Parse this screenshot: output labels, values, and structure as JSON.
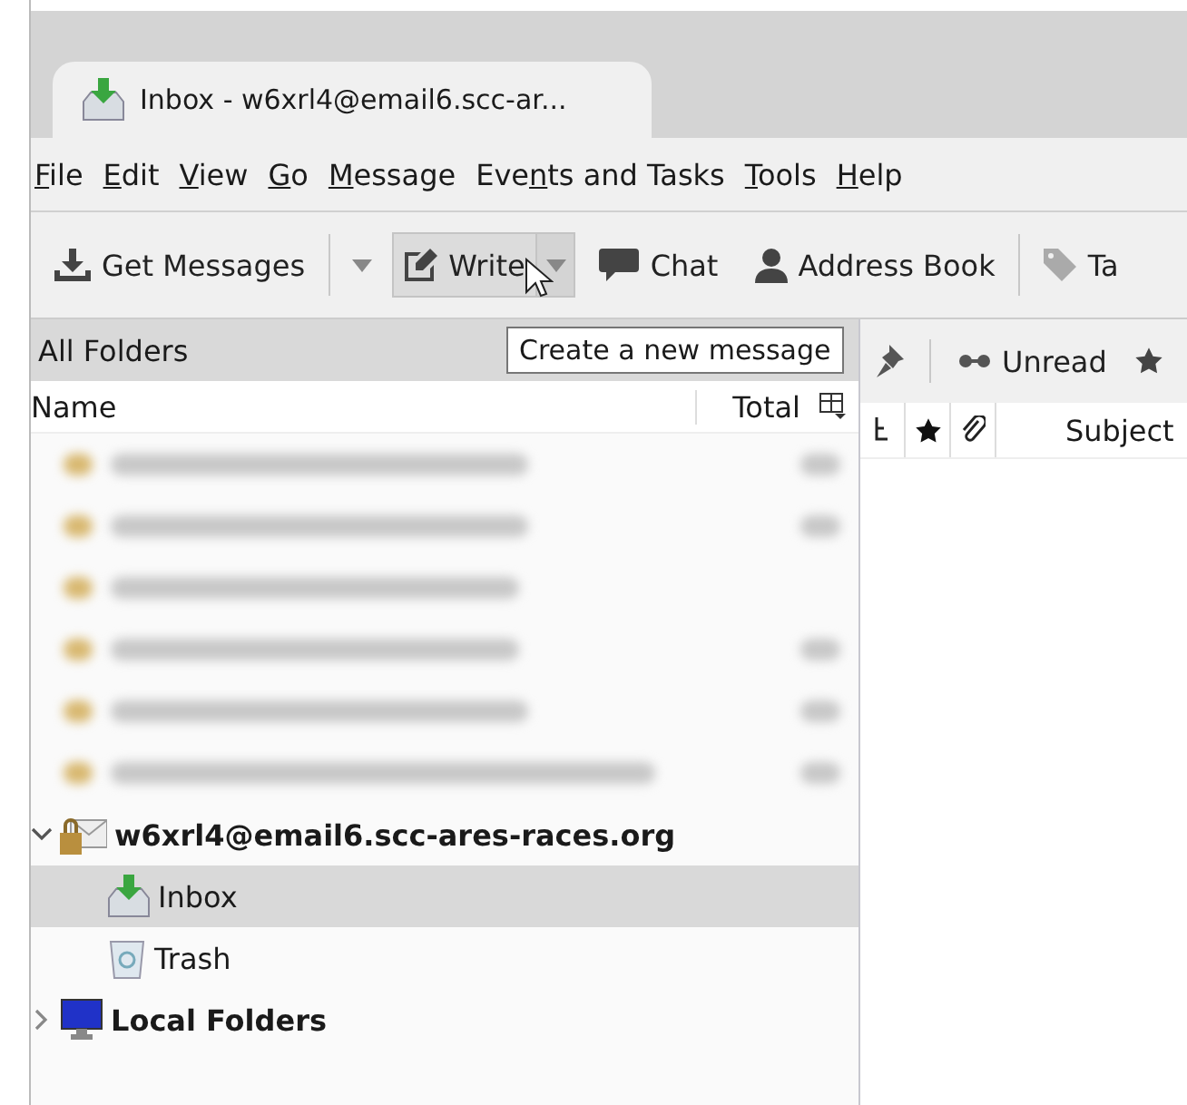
{
  "tab": {
    "title": "Inbox - w6xrl4@email6.scc-ar..."
  },
  "menu": [
    {
      "key": "F",
      "after": "ile"
    },
    {
      "key": "E",
      "after": "dit"
    },
    {
      "key": "V",
      "after": "iew"
    },
    {
      "key": "G",
      "after": "o"
    },
    {
      "key": "M",
      "after": "essage"
    },
    {
      "before": "Eve",
      "key": "n",
      "after": "ts and Tasks"
    },
    {
      "key": "T",
      "after": "ools"
    },
    {
      "key": "H",
      "after": "elp"
    }
  ],
  "toolbar": [
    {
      "kind": "get",
      "label": "Get Messages",
      "pressed": false
    },
    {
      "kind": "write",
      "label": "Write",
      "pressed": true
    },
    {
      "kind": "chat",
      "label": "Chat",
      "pressed": false
    },
    {
      "kind": "address",
      "label": "Address Book",
      "pressed": false
    },
    {
      "kind": "tag",
      "label": "Ta",
      "pressed": false
    }
  ],
  "tooltip": "Create a new message",
  "folder_pane": {
    "title": "All Folders",
    "columns": [
      "Name",
      "Total"
    ],
    "blurred_rows": [
      {
        "total_shown": true
      },
      {
        "total_shown": true
      },
      {
        "total_shown": false
      },
      {
        "total_shown": true
      },
      {
        "total_shown": true
      },
      {
        "total_shown": true
      }
    ],
    "tree": [
      {
        "kind": "account",
        "label": "w6xrl4@email6.scc-ares-races.org",
        "expanded": true,
        "selected": false,
        "children": [
          {
            "kind": "inbox",
            "label": "Inbox",
            "selected": true
          },
          {
            "kind": "trash",
            "label": "Trash",
            "selected": false
          }
        ]
      },
      {
        "kind": "local",
        "label": "Local Folders",
        "expanded": false,
        "selected": false
      }
    ]
  },
  "thread_pane": {
    "filters": [
      "Unread"
    ],
    "columns": [
      "Subject"
    ]
  }
}
